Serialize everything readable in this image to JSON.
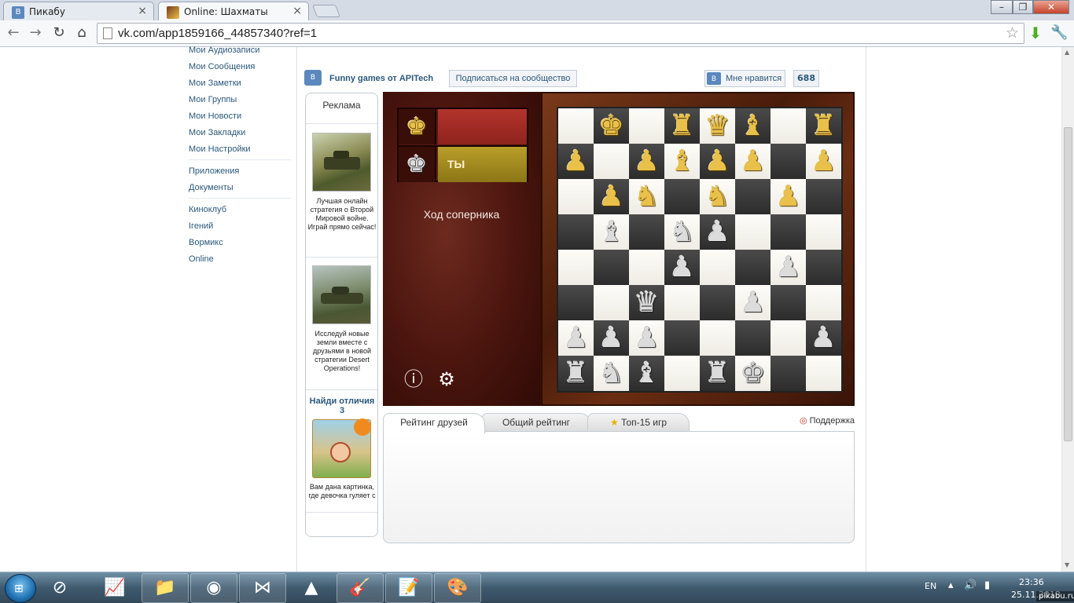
{
  "browser": {
    "tabs": [
      {
        "title": "Пикабу",
        "active": false
      },
      {
        "title": "Online: Шахматы",
        "active": true
      }
    ],
    "url": "vk.com/app1859166_44857340?ref=1",
    "icons": {
      "back": "back-arrow-icon",
      "forward": "forward-arrow-icon",
      "reload": "reload-icon",
      "home": "home-icon",
      "bookmark": "star-icon",
      "download": "download-icon",
      "menu": "wrench-icon"
    }
  },
  "vk_menu": {
    "group1": [
      "Мои Аудиозаписи",
      "Мои Сообщения",
      "Мои Заметки",
      "Мои Группы",
      "Мои Новости",
      "Мои Закладки",
      "Мои Настройки"
    ],
    "group2": [
      "Приложения",
      "Документы"
    ],
    "group3": [
      "Киноклуб",
      "Iгений",
      "Вормикс",
      "Online"
    ]
  },
  "app_header": {
    "logo_letter": "B",
    "title": "Funny games от APITech",
    "subscribe_label": "Подписаться на сообщество",
    "like_label": "Мне нравится",
    "like_count": "688"
  },
  "ads": {
    "header": "Реклама",
    "items": [
      {
        "text": "Лучшая онлайн стратегия о Второй Мировой войне. Играй прямо сейчас!"
      },
      {
        "text": "Исследуй новые земли вместе с друзьями в новой стратегии Desert Operations!"
      },
      {
        "title": "Найди отличия 3",
        "text": "Вам дана картинка, где девочка гуляет с"
      }
    ]
  },
  "game": {
    "opponent": {
      "piece": "♚",
      "color": "gold"
    },
    "you": {
      "piece": "♚",
      "color": "silver",
      "name": "ТЫ"
    },
    "status": "Ход соперника",
    "colors": {
      "opponent_bar": "#9a2a24",
      "you_bar": "#a08a22"
    },
    "board": [
      [
        "",
        "gK",
        "",
        "gR",
        "gQ",
        "gB",
        "",
        "gR"
      ],
      [
        "gP",
        "",
        "gP",
        "gB",
        "gP",
        "gP",
        "",
        "gP"
      ],
      [
        "",
        "gP",
        "gN",
        "",
        "gN",
        "",
        "gP",
        ""
      ],
      [
        "",
        "wB",
        "",
        "wN",
        "wP",
        "",
        "",
        ""
      ],
      [
        "",
        "",
        "",
        "wP",
        "",
        "",
        "wP",
        ""
      ],
      [
        "",
        "",
        "wQ",
        "",
        "",
        "wP",
        "",
        ""
      ],
      [
        "wP",
        "wP",
        "wP",
        "",
        "",
        "",
        "",
        "wP"
      ],
      [
        "wR",
        "wN",
        "wB",
        "",
        "wR",
        "wK",
        "",
        ""
      ]
    ]
  },
  "rating": {
    "tabs": [
      {
        "label": "Рейтинг друзей",
        "active": true
      },
      {
        "label": "Общий рейтинг",
        "active": false
      },
      {
        "label": "Топ-15 игр",
        "active": false
      }
    ],
    "support_label": "Поддержка"
  },
  "taskbar": {
    "lang": "EN",
    "time": "23:36",
    "date": "25.11.2013",
    "watermark": "pikabu.ru"
  }
}
